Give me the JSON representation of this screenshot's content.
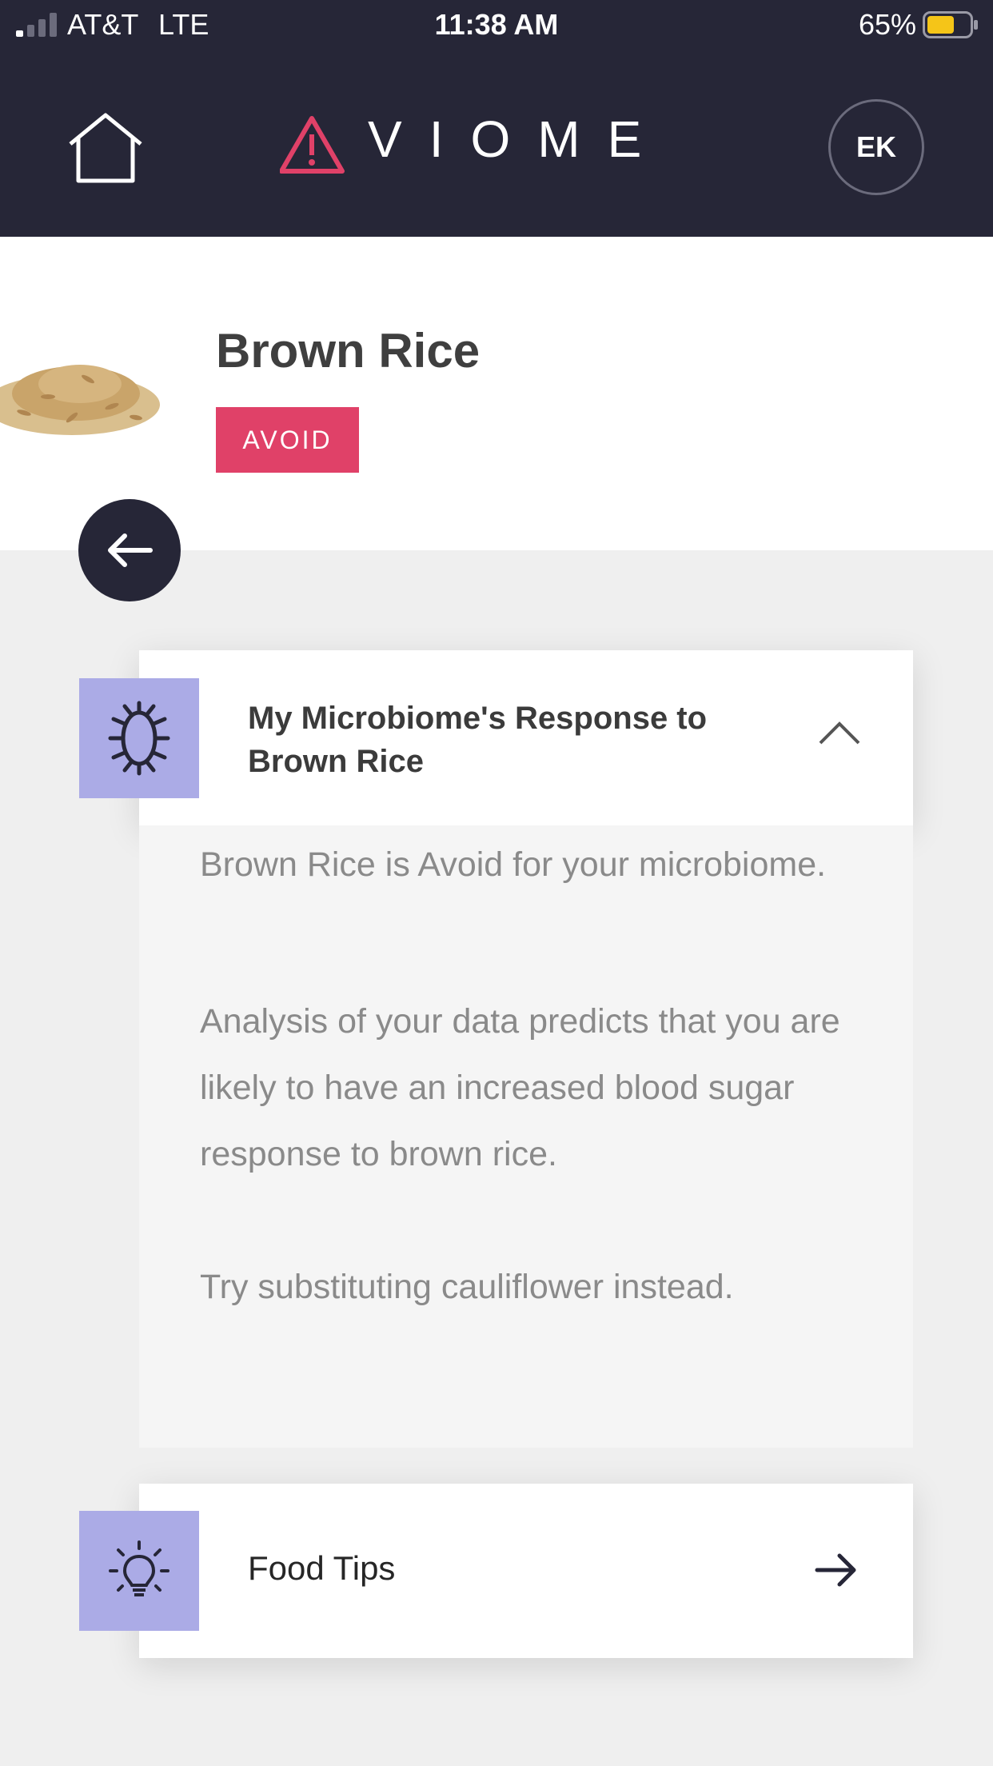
{
  "status_bar": {
    "carrier": "AT&T",
    "network": "LTE",
    "time": "11:38 AM",
    "battery": "65%",
    "battery_level": 0.65,
    "battery_color": "#f5c518"
  },
  "header": {
    "logo_text": "VIOME",
    "avatar_initials": "EK",
    "background": "#262637"
  },
  "food": {
    "name": "Brown Rice",
    "badge": "AVOID",
    "badge_color": "#e04168"
  },
  "microbiome_card": {
    "title": "My Microbiome's Response to Brown Rice",
    "icon": "bacteria-icon",
    "expanded": true,
    "paragraphs": [
      "Brown Rice is Avoid for your microbiome.",
      "Analysis of your data predicts that you are likely to have an increased blood sugar response to brown rice.",
      "Try substituting cauliflower instead."
    ]
  },
  "food_tips_card": {
    "title": "Food Tips",
    "icon": "lightbulb-icon"
  },
  "accent_color": "#ababe6"
}
